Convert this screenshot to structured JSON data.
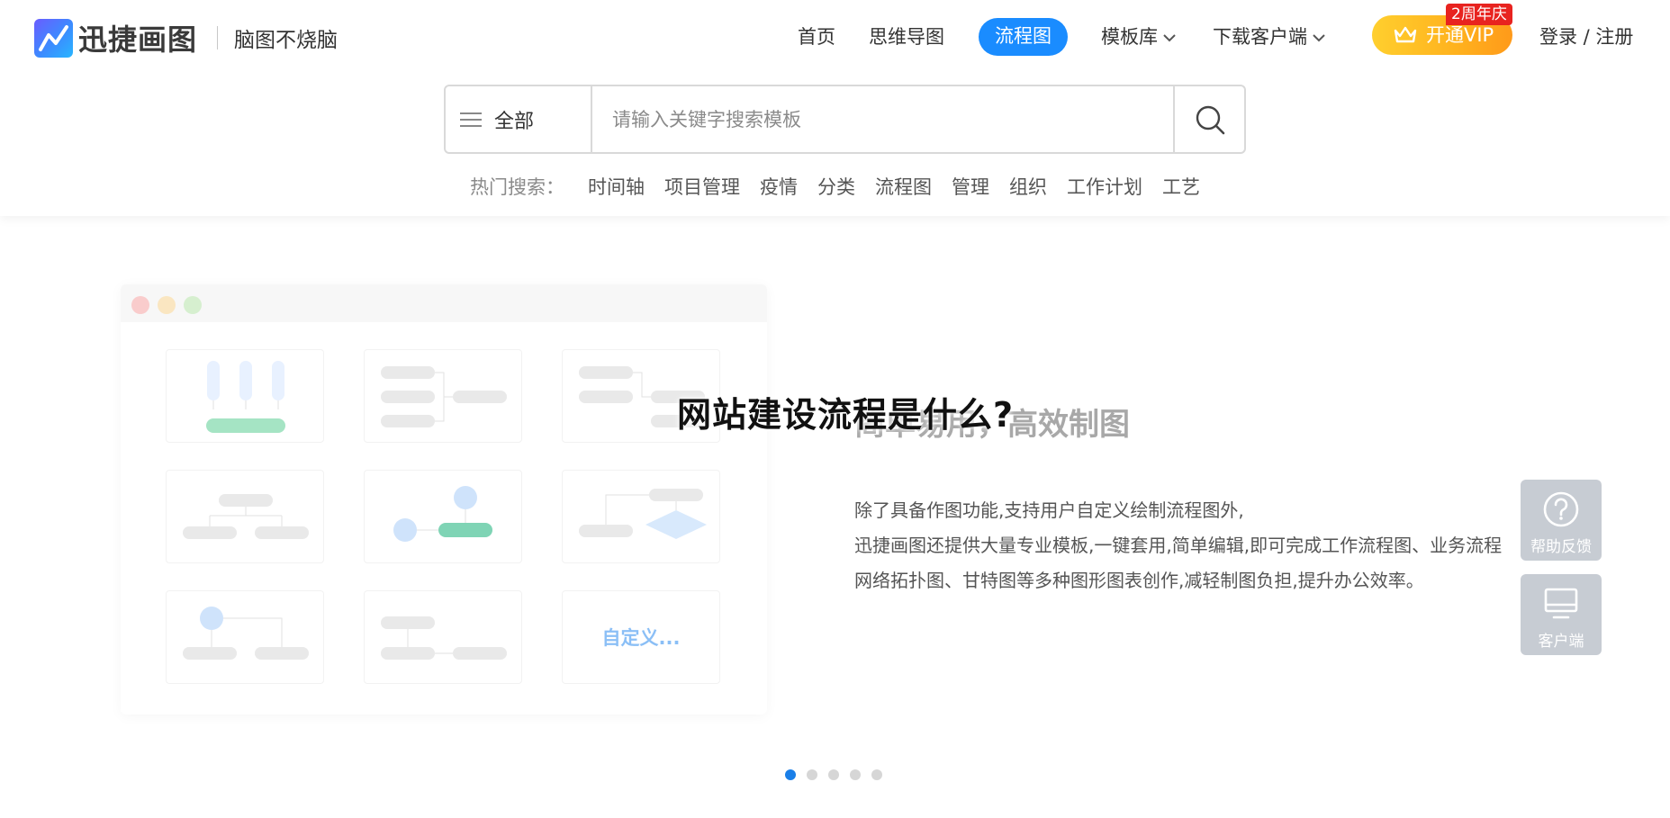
{
  "brand": {
    "name": "迅捷画图",
    "slogan": "脑图不烧脑",
    "accent": "#1a8cff"
  },
  "nav": {
    "items": [
      {
        "label": "首页"
      },
      {
        "label": "思维导图"
      },
      {
        "label": "流程图",
        "active": true
      },
      {
        "label": "模板库",
        "dropdown": true
      },
      {
        "label": "下载客户端",
        "dropdown": true
      }
    ],
    "vip": {
      "label": "开通VIP",
      "badge": "2周年庆",
      "icon": "crown-icon"
    },
    "login": "登录 / 注册"
  },
  "search": {
    "category": "全部",
    "placeholder": "请输入关键字搜索模板",
    "value": "",
    "hot_label": "热门搜索：",
    "hot_tags": [
      "时间轴",
      "项目管理",
      "疫情",
      "分类",
      "流程图",
      "管理",
      "组织",
      "工作计划",
      "工艺"
    ]
  },
  "banner": {
    "overlay_title": "网站建设流程是什么?",
    "subtitle": "简单易用，高效制图",
    "description": [
      "除了具备作图功能,支持用户自定义绘制流程图外,",
      "迅捷画图还提供大量专业模板,一键套用,简单编辑,即可完成工作流程图、业务流程",
      "网络拓扑图、甘特图等多种图形图表创作,减轻制图负担,提升办公效率。"
    ],
    "mockup_custom_label": "自定义...",
    "slide_count": 5,
    "active_slide": 0
  },
  "float": {
    "help": {
      "label": "帮助反馈",
      "icon": "question-circle-icon"
    },
    "client": {
      "label": "客户端",
      "icon": "monitor-icon"
    }
  }
}
